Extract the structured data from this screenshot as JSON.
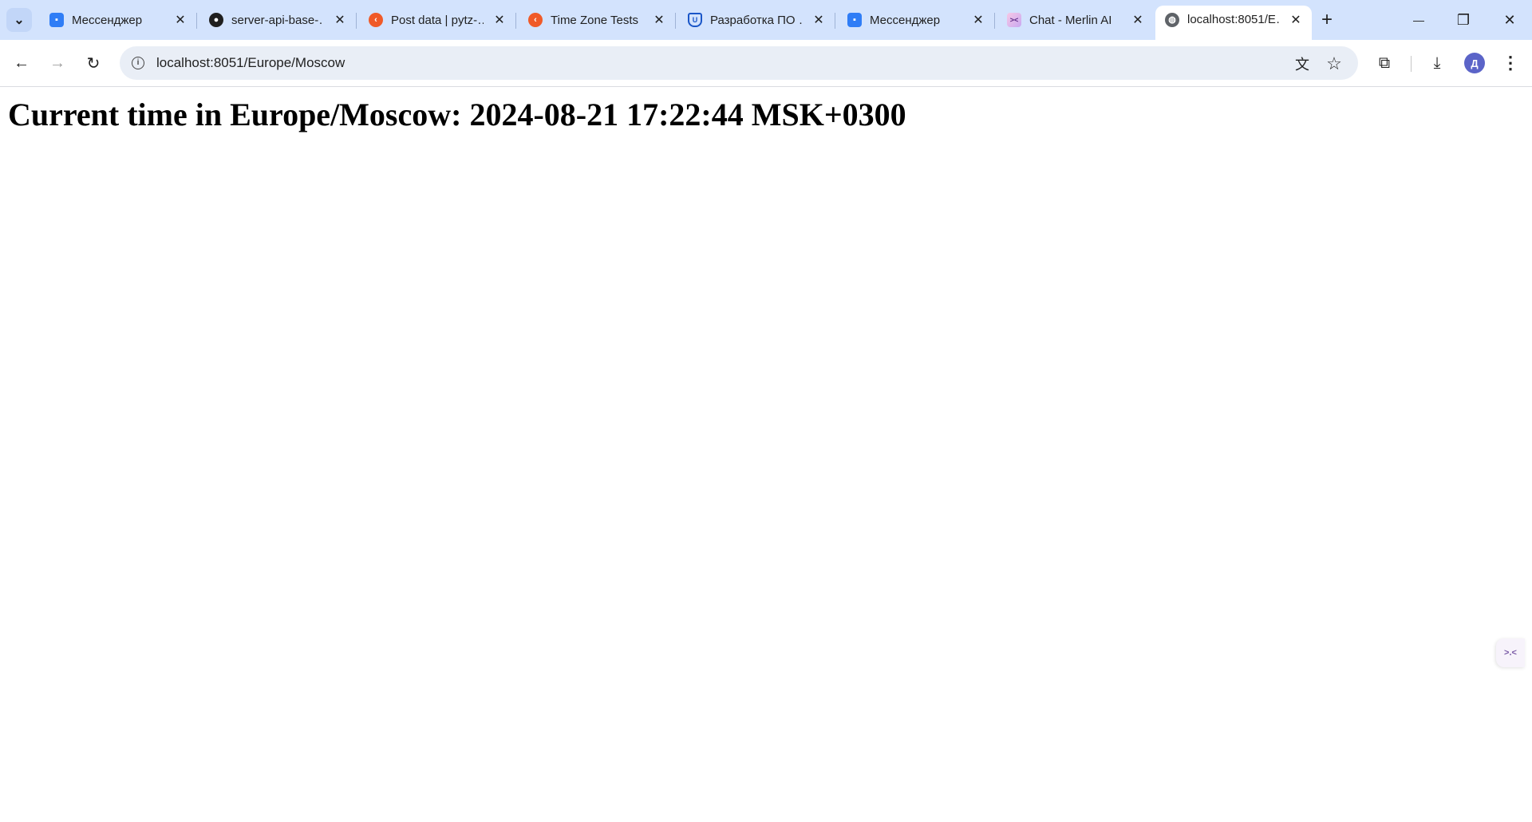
{
  "browser": {
    "tabs": [
      {
        "title": "Мессенджер",
        "favicon": "messenger-icon",
        "active": false
      },
      {
        "title": "server-api-base-…",
        "favicon": "github-icon",
        "active": false
      },
      {
        "title": "Post data | pytz-…",
        "favicon": "pytz-icon",
        "active": false
      },
      {
        "title": "Time Zone Tests",
        "favicon": "pytz-icon",
        "active": false
      },
      {
        "title": "Разработка ПО …",
        "favicon": "urfu-icon",
        "active": false
      },
      {
        "title": "Мессенджер",
        "favicon": "messenger-icon",
        "active": false
      },
      {
        "title": "Chat - Merlin AI",
        "favicon": "merlin-icon",
        "active": false
      },
      {
        "title": "localhost:8051/E…",
        "favicon": "globe-icon",
        "active": true
      }
    ],
    "address": "localhost:8051/Europe/Moscow",
    "profile_initial": "Д",
    "icons": {
      "close": "✕",
      "new_tab": "+",
      "minimize": "—",
      "restore": "❐",
      "window_close": "✕",
      "back": "←",
      "forward": "→",
      "reload": "↻",
      "translate": "文",
      "bookmark": "☆",
      "extensions": "⧉",
      "download": "⤓",
      "menu": "⋮",
      "tab_search": "⌄"
    }
  },
  "page": {
    "heading": "Current time in Europe/Moscow: 2024-08-21 17:22:44 MSK+0300"
  },
  "colors": {
    "tabstrip": "#d3e3fd",
    "omnibox": "#e9eef6",
    "avatar": "#5b64c8"
  }
}
